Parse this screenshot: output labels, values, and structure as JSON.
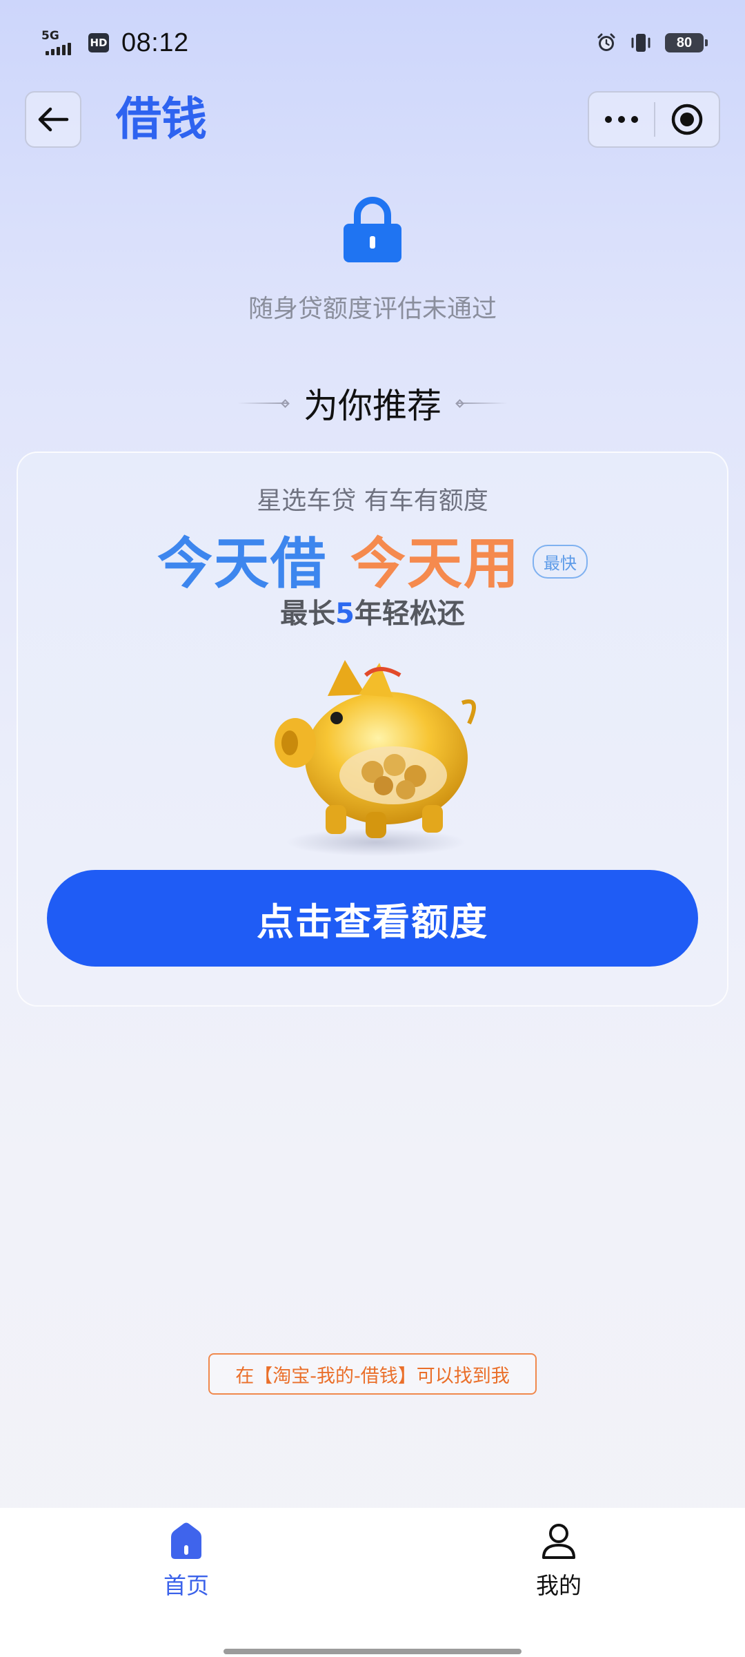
{
  "status_bar": {
    "network": "5G",
    "hd": "HD",
    "time": "08:12",
    "battery": "80",
    "icons": [
      "signal-icon",
      "hd-icon",
      "alarm-icon",
      "vibrate-icon",
      "battery-icon"
    ]
  },
  "header": {
    "title": "借钱",
    "icons": [
      "back-arrow-icon",
      "more-dots-icon",
      "close-target-icon"
    ]
  },
  "status_message": {
    "icon": "lock-icon",
    "text": "随身贷额度评估未通过"
  },
  "recommend": {
    "heading": "为你推荐",
    "card": {
      "subtitle": "星选车贷 有车有额度",
      "slogan_part1": "今天借",
      "slogan_part2": "今天用",
      "tag": "最快",
      "term_prefix": "最长",
      "term_number": "5",
      "term_suffix": "年轻松还",
      "image": "golden-piggy-bank-icon",
      "cta_label": "点击查看额度"
    }
  },
  "hint": "在【淘宝-我的-借钱】可以找到我",
  "tabbar": {
    "tabs": [
      {
        "label": "首页",
        "icon": "home-icon",
        "active": true
      },
      {
        "label": "我的",
        "icon": "user-icon",
        "active": false
      }
    ]
  },
  "colors": {
    "accent": "#1f5cf5",
    "title": "#2e63f0",
    "slogan_blue": "#3d86ee",
    "slogan_orange": "#f58a4e",
    "hint_orange": "#ea6f2a"
  }
}
